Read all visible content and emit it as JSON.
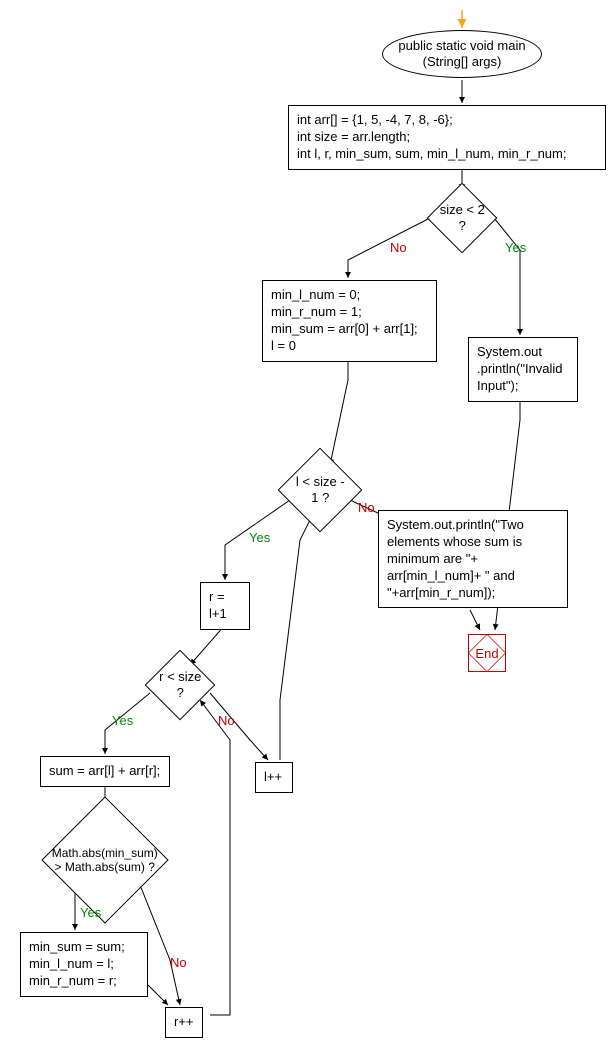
{
  "chart_data": {
    "type": "flowchart",
    "nodes": [
      {
        "id": "start",
        "kind": "terminator",
        "lines": [
          "public static void main",
          "(String[] args)"
        ]
      },
      {
        "id": "init",
        "kind": "process",
        "lines": [
          "int arr[] = {1, 5, -4, 7, 8, -6};",
          "int size = arr.length;",
          "int l, r, min_sum, sum, min_l_num, min_r_num;"
        ]
      },
      {
        "id": "sizeCheck",
        "kind": "decision",
        "lines": [
          "size < 2 ?"
        ]
      },
      {
        "id": "minsInit",
        "kind": "process",
        "lines": [
          "min_l_num = 0;",
          "min_r_num = 1;",
          "min_sum = arr[0] + arr[1];",
          "l = 0"
        ]
      },
      {
        "id": "invalid",
        "kind": "process",
        "lines": [
          "System.out",
          ".println(\"Invalid",
          "Input\");"
        ]
      },
      {
        "id": "outerLoop",
        "kind": "decision",
        "lines": [
          "l < size - 1 ?"
        ]
      },
      {
        "id": "printResult",
        "kind": "process",
        "lines": [
          "System.out.println(\"Two",
          "elements whose sum is",
          "minimum are \"+",
          "arr[min_l_num]+ \" and",
          "\"+arr[min_r_num]);"
        ]
      },
      {
        "id": "rAssign",
        "kind": "process",
        "lines": [
          "r = l+1"
        ]
      },
      {
        "id": "innerLoop",
        "kind": "decision",
        "lines": [
          "r < size ?"
        ]
      },
      {
        "id": "sumAssign",
        "kind": "process",
        "lines": [
          "sum = arr[l] + arr[r];"
        ]
      },
      {
        "id": "lpp",
        "kind": "process",
        "lines": [
          "l++"
        ]
      },
      {
        "id": "absCheck",
        "kind": "decision",
        "lines": [
          "Math.abs(min_sum)",
          "> Math.abs(sum) ?"
        ]
      },
      {
        "id": "updateMins",
        "kind": "process",
        "lines": [
          "min_sum = sum;",
          "min_l_num = l;",
          "min_r_num = r;"
        ]
      },
      {
        "id": "rpp",
        "kind": "process",
        "lines": [
          "r++"
        ]
      },
      {
        "id": "end",
        "kind": "end",
        "label": "End"
      }
    ],
    "edges": [
      {
        "from": "start",
        "to": "init"
      },
      {
        "from": "init",
        "to": "sizeCheck"
      },
      {
        "from": "sizeCheck",
        "to": "minsInit",
        "label": "No"
      },
      {
        "from": "sizeCheck",
        "to": "invalid",
        "label": "Yes"
      },
      {
        "from": "minsInit",
        "to": "outerLoop"
      },
      {
        "from": "outerLoop",
        "to": "rAssign",
        "label": "Yes"
      },
      {
        "from": "outerLoop",
        "to": "printResult",
        "label": "No"
      },
      {
        "from": "rAssign",
        "to": "innerLoop"
      },
      {
        "from": "innerLoop",
        "to": "sumAssign",
        "label": "Yes"
      },
      {
        "from": "innerLoop",
        "to": "lpp",
        "label": "No"
      },
      {
        "from": "lpp",
        "to": "outerLoop"
      },
      {
        "from": "sumAssign",
        "to": "absCheck"
      },
      {
        "from": "absCheck",
        "to": "updateMins",
        "label": "Yes"
      },
      {
        "from": "absCheck",
        "to": "rpp",
        "label": "No"
      },
      {
        "from": "updateMins",
        "to": "rpp"
      },
      {
        "from": "rpp",
        "to": "innerLoop"
      },
      {
        "from": "printResult",
        "to": "end"
      },
      {
        "from": "invalid",
        "to": "end"
      }
    ]
  },
  "labels": {
    "yes": "Yes",
    "no": "No",
    "end": "End"
  }
}
